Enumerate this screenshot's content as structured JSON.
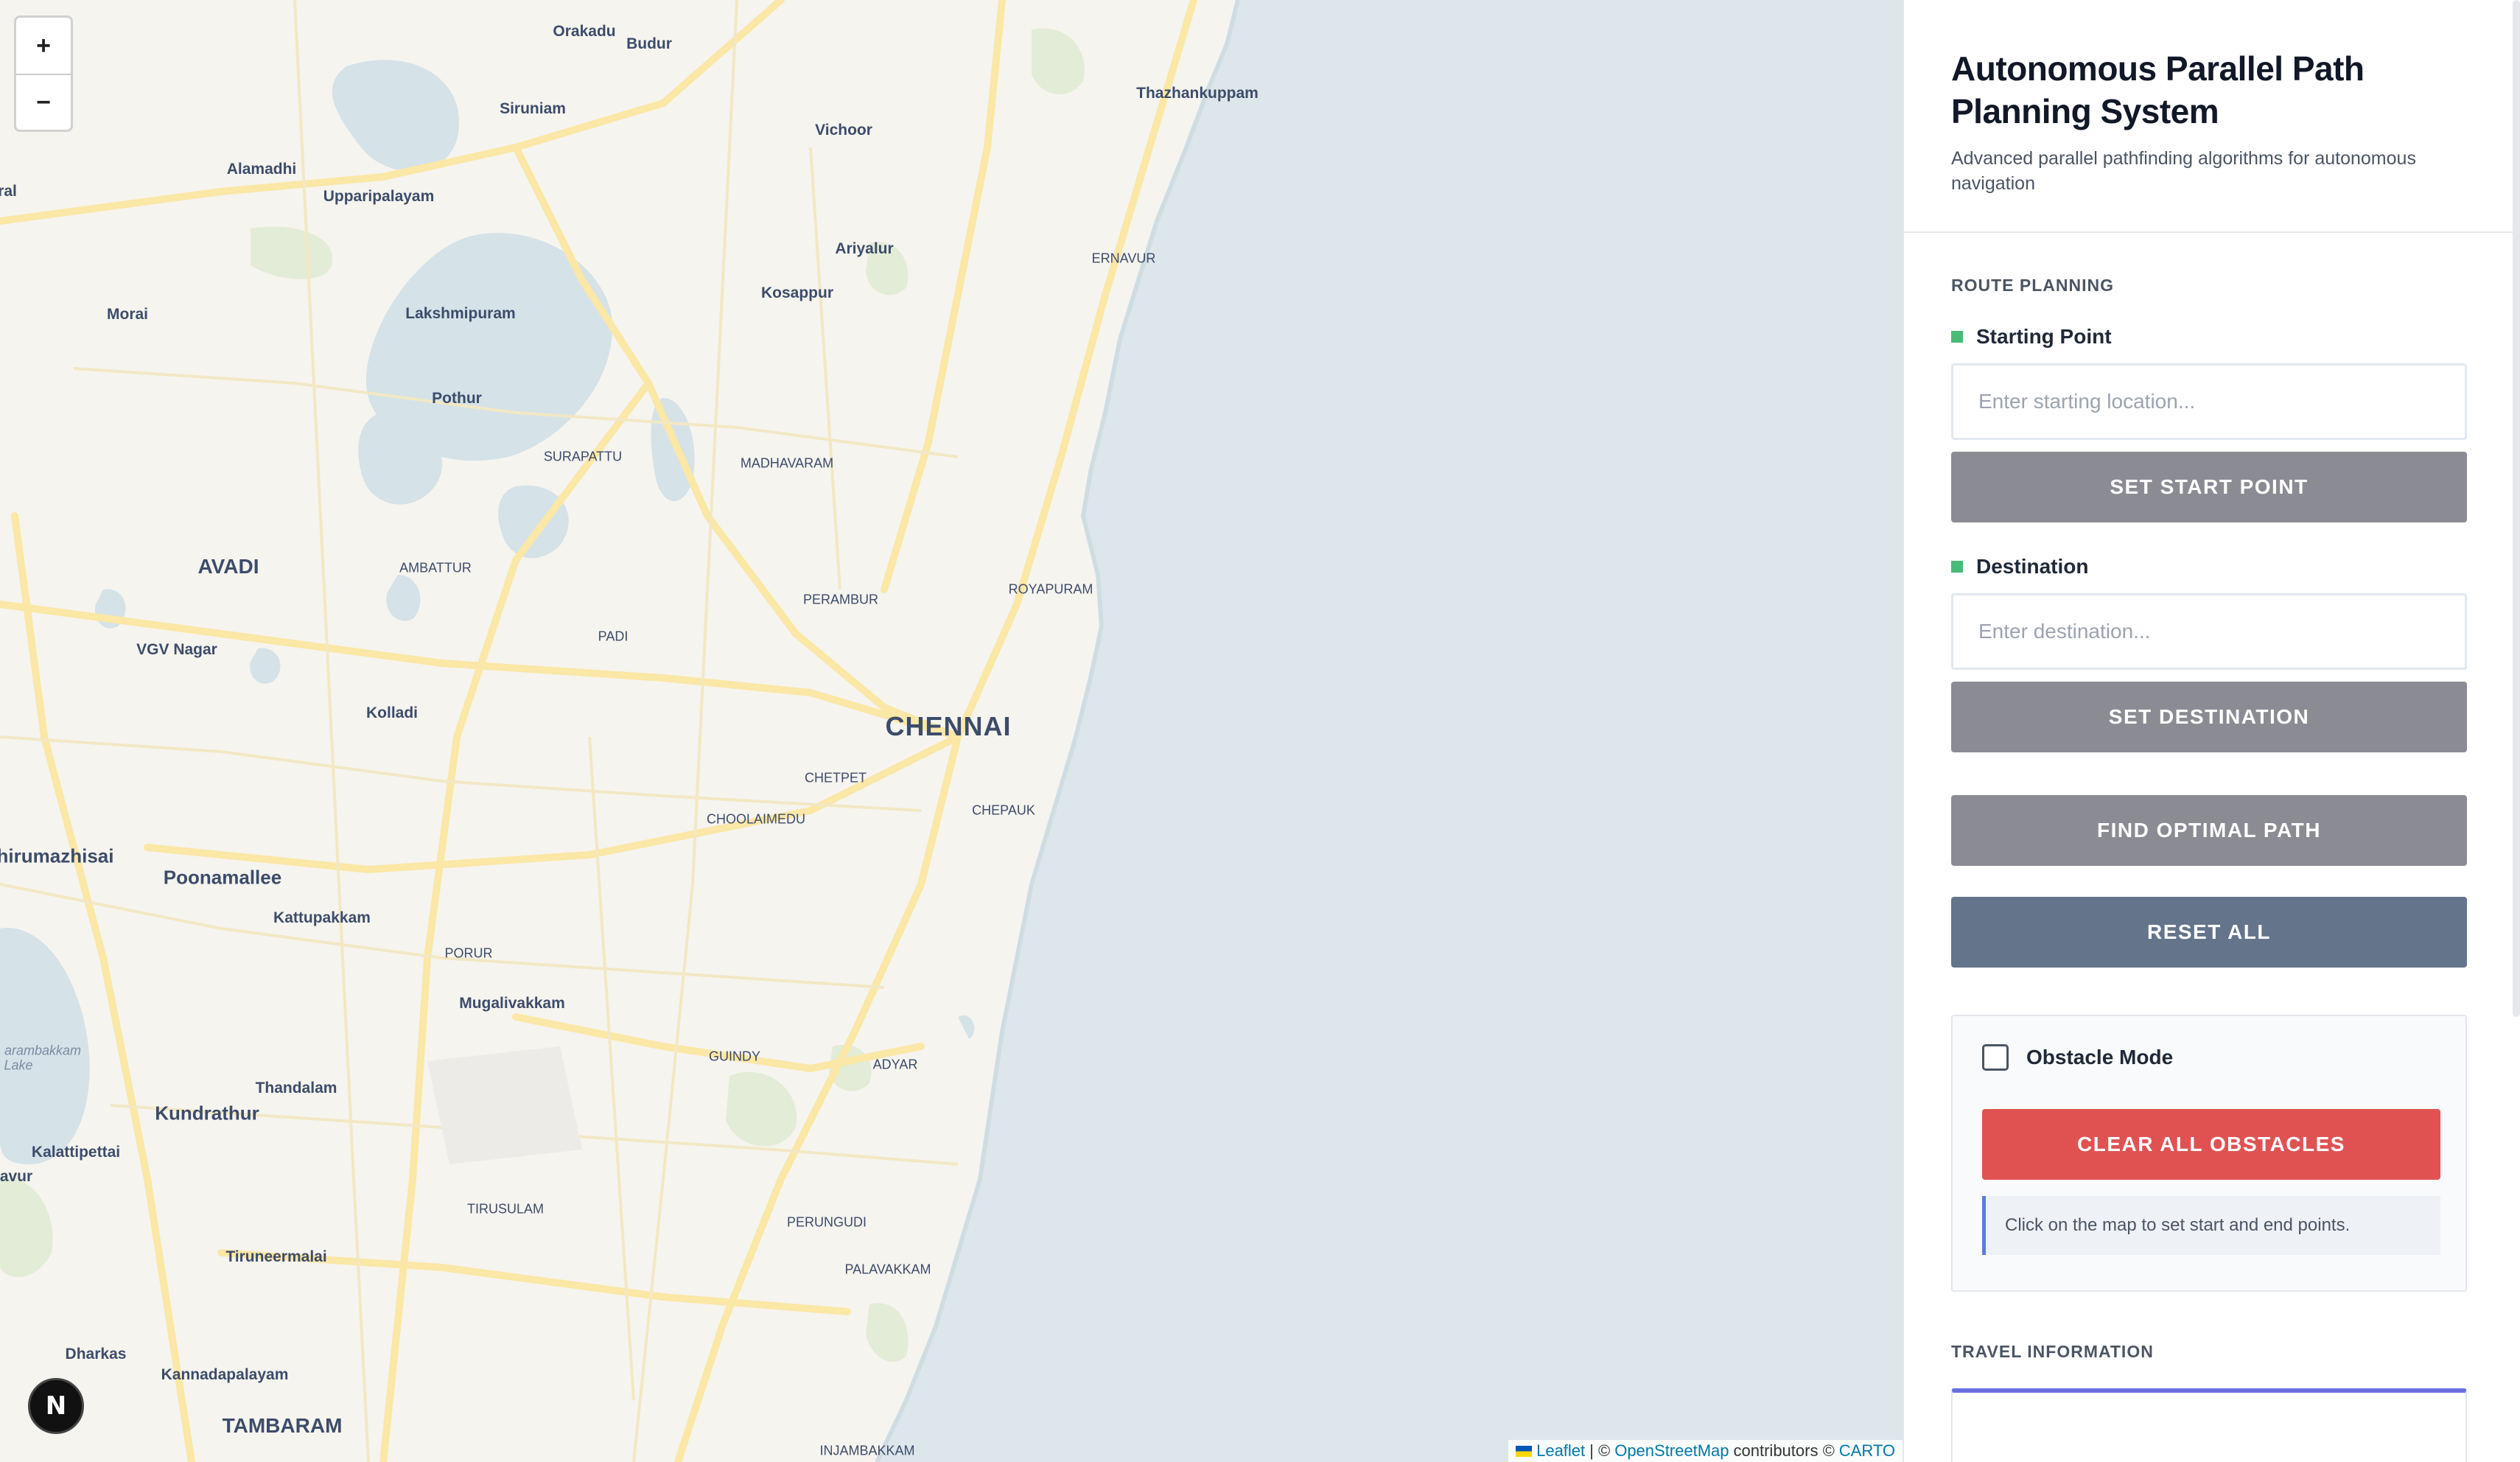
{
  "map": {
    "zoom_in": "+",
    "zoom_out": "−",
    "labels": [
      {
        "text": "Orakadu",
        "cls": "town"
      },
      {
        "text": "Budur",
        "cls": "town"
      },
      {
        "text": "Thazhankuppam",
        "cls": "town"
      },
      {
        "text": "Siruniam",
        "cls": "town"
      },
      {
        "text": "Vichoor",
        "cls": "town"
      },
      {
        "text": "Alamadhi",
        "cls": "town"
      },
      {
        "text": "Upparipalayam",
        "cls": "town"
      },
      {
        "text": "ral",
        "cls": "town"
      },
      {
        "text": "Ariyalur",
        "cls": "town"
      },
      {
        "text": "ERNAVUR",
        "cls": "district"
      },
      {
        "text": "Kosappur",
        "cls": "town"
      },
      {
        "text": "Morai",
        "cls": "town"
      },
      {
        "text": "Lakshmipuram",
        "cls": "town"
      },
      {
        "text": "Pothur",
        "cls": "town"
      },
      {
        "text": "SURAPATTU",
        "cls": "district"
      },
      {
        "text": "MADHAVARAM",
        "cls": "district"
      },
      {
        "text": "AVADI",
        "cls": "mid"
      },
      {
        "text": "AMBATTUR",
        "cls": "district"
      },
      {
        "text": "ROYAPURAM",
        "cls": "district"
      },
      {
        "text": "PERAMBUR",
        "cls": "district"
      },
      {
        "text": "PADI",
        "cls": "district"
      },
      {
        "text": "VGV Nagar",
        "cls": "town"
      },
      {
        "text": "Kolladi",
        "cls": "town"
      },
      {
        "text": "CHENNAI",
        "cls": "city"
      },
      {
        "text": "CHETPET",
        "cls": "district"
      },
      {
        "text": "CHEPAUK",
        "cls": "district"
      },
      {
        "text": "CHOOLAIMEDU",
        "cls": "district"
      },
      {
        "text": "hirumazhisai",
        "cls": "mid"
      },
      {
        "text": "Poonamallee",
        "cls": "mid"
      },
      {
        "text": "Kattupakkam",
        "cls": "town"
      },
      {
        "text": "PORUR",
        "cls": "district"
      },
      {
        "text": "Mugalivakkam",
        "cls": "town"
      },
      {
        "text": "arambakkam",
        "cls": "lake"
      },
      {
        "text": "Lake",
        "cls": "lake"
      },
      {
        "text": "GUINDY",
        "cls": "district"
      },
      {
        "text": "ADYAR",
        "cls": "district"
      },
      {
        "text": "Thandalam",
        "cls": "town"
      },
      {
        "text": "Kundrathur",
        "cls": "mid"
      },
      {
        "text": "Kalattipettai",
        "cls": "town"
      },
      {
        "text": "avur",
        "cls": "town"
      },
      {
        "text": "TIRUSULAM",
        "cls": "district"
      },
      {
        "text": "PERUNGUDI",
        "cls": "district"
      },
      {
        "text": "Tiruneermalai",
        "cls": "town"
      },
      {
        "text": "PALAVAKKAM",
        "cls": "district"
      },
      {
        "text": "Dharkas",
        "cls": "town"
      },
      {
        "text": "Kannadapalayam",
        "cls": "town"
      },
      {
        "text": "TAMBARAM",
        "cls": "mid"
      },
      {
        "text": "INJAMBAKKAM",
        "cls": "district"
      }
    ],
    "attribution": {
      "leaflet": "Leaflet",
      "sep": "| ©",
      "osm": "OpenStreetMap",
      "contributors": "contributors ©",
      "carto": "CARTO"
    },
    "badge": "N"
  },
  "sidebar": {
    "title": "Autonomous Parallel Path Planning System",
    "subtitle": "Advanced parallel pathfinding algorithms for autonomous navigation",
    "route_section": "ROUTE PLANNING",
    "start": {
      "label": "Starting Point",
      "placeholder": "Enter starting location...",
      "button": "SET START POINT"
    },
    "destination": {
      "label": "Destination",
      "placeholder": "Enter destination...",
      "button": "SET DESTINATION"
    },
    "find_button": "FIND OPTIMAL PATH",
    "reset_button": "RESET ALL",
    "obstacle": {
      "label": "Obstacle Mode",
      "checked": false,
      "clear_button": "CLEAR ALL OBSTACLES",
      "note": "Click on the map to set start and end points."
    },
    "travel_section": "TRAVEL INFORMATION"
  },
  "colors": {
    "sea": "#dde6ea",
    "land": "#f6f4ef",
    "road": "#fbe7a6",
    "green": "#e3ecd6",
    "water": "#d5e2e8",
    "accent_green": "#48bb78",
    "button_gray": "#8b8c93",
    "button_slate": "#64748b",
    "button_red": "#e05252",
    "travel_accent": "#6b6fe0"
  }
}
